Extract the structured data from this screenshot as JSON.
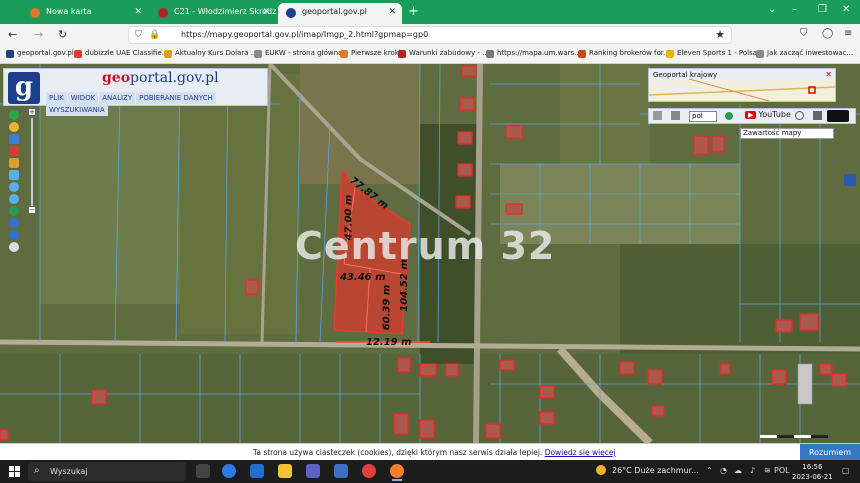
{
  "tabs": [
    {
      "label": "Nowa karta",
      "color": "#e8762d"
    },
    {
      "label": "C21 - Włodzimierz Skrodzki",
      "color": "#b32323"
    },
    {
      "label": "geoportal.gov.pl",
      "color": "#1d3e8c",
      "active": true
    }
  ],
  "window_controls": {
    "minimize": "–",
    "restore": "❐",
    "close": "✕"
  },
  "nav": {
    "back": "←",
    "forward": "→",
    "reload": "↻",
    "url": "https://mapy.geoportal.gov.pl/imap/Imgp_2.html?gpmap=gp0"
  },
  "bookmarks": [
    {
      "label": "geoportal.gov.pl",
      "color": "#1d3e8c"
    },
    {
      "label": "dubizzle UAE Classifie...",
      "color": "#e23a2e"
    },
    {
      "label": "Aktualny Kurs Dolara ...",
      "color": "#d9a400"
    },
    {
      "label": "EUKW - strona główna",
      "color": "#8a8a8a"
    },
    {
      "label": "Pierwsze kroki",
      "color": "#e8762d"
    },
    {
      "label": "Warunki zabudowy - ...",
      "color": "#b32323"
    },
    {
      "label": "https://mapa.um.wars...",
      "color": "#777777"
    },
    {
      "label": "Ranking brokerów for...",
      "color": "#c84a1a"
    },
    {
      "label": "Eleven Sports 1 - Polsa...",
      "color": "#e8b400"
    },
    {
      "label": "Jak zacząć inwestowac...",
      "color": "#888888"
    }
  ],
  "geoportal": {
    "logo_letter": "g",
    "name_prefix": "geo",
    "name_suffix": "portal.gov.pl",
    "menu": [
      "PLIK",
      "WIDOK",
      "ANALIZY",
      "POBIERANIE DANYCH",
      "WYSZUKIWANIA"
    ],
    "overview_title": "Geoportal krajowy",
    "overview_close": "✕",
    "language": "pol",
    "youtube_label": "YouTube",
    "youtube_badge": "▶",
    "content_label": "Zawartość mapy",
    "zoom_in": "+",
    "zoom_out": "−"
  },
  "map": {
    "watermark": "Centrum 32",
    "measurements": [
      "77.87 m",
      "47.00 m",
      "43.46 m",
      "104.52 m",
      "60.39 m",
      "12.19 m"
    ]
  },
  "cookie": {
    "text": "Ta strona używa ciasteczek (cookies), dzięki którym nasz serwis działa lepiej.",
    "link": "Dowiedz się więcej",
    "button": "Rozumiem"
  },
  "taskbar": {
    "search_placeholder": "Wyszukaj",
    "weather": "26°C  Duże zachmur...",
    "lang": "POL",
    "time": "16:56",
    "date": "2023-06-21"
  }
}
